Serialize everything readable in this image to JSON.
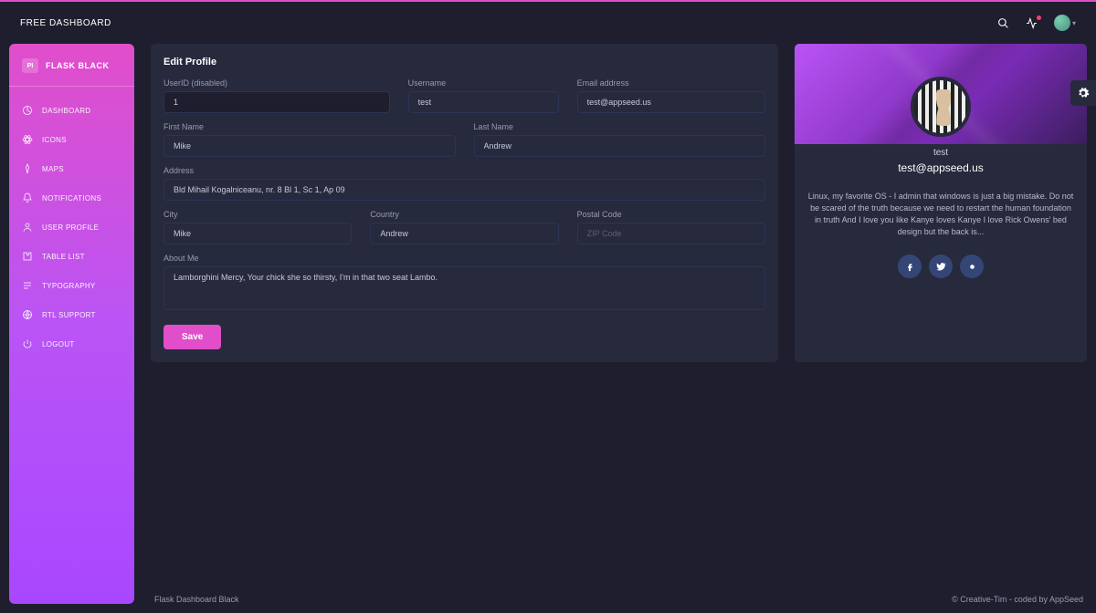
{
  "topbar": {
    "title": "FREE DASHBOARD"
  },
  "brand": {
    "logo": "PI",
    "name": "FLASK BLACK"
  },
  "sidebar": {
    "items": [
      {
        "label": "DASHBOARD",
        "icon": "chart"
      },
      {
        "label": "ICONS",
        "icon": "atom"
      },
      {
        "label": "MAPS",
        "icon": "pin"
      },
      {
        "label": "NOTIFICATIONS",
        "icon": "bell"
      },
      {
        "label": "USER PROFILE",
        "icon": "user",
        "active": true
      },
      {
        "label": "TABLE LIST",
        "icon": "puzzle"
      },
      {
        "label": "TYPOGRAPHY",
        "icon": "align"
      },
      {
        "label": "RTL SUPPORT",
        "icon": "globe"
      },
      {
        "label": "LOGOUT",
        "icon": "power"
      }
    ]
  },
  "form": {
    "title": "Edit Profile",
    "labels": {
      "userid": "UserID (disabled)",
      "username": "Username",
      "email": "Email address",
      "first": "First Name",
      "last": "Last Name",
      "address": "Address",
      "city": "City",
      "country": "Country",
      "postal": "Postal Code",
      "about": "About Me"
    },
    "values": {
      "userid": "1",
      "username": "test",
      "email": "test@appseed.us",
      "first": "Mike",
      "last": "Andrew",
      "address": "Bld Mihail Kogalniceanu, nr. 8 Bl 1, Sc 1, Ap 09",
      "city": "Mike",
      "country": "Andrew",
      "postal": "",
      "about": "Lamborghini Mercy, Your chick she so thirsty, I'm in that two seat Lambo."
    },
    "placeholders": {
      "postal": "ZIP Code"
    },
    "save": "Save"
  },
  "profile": {
    "name": "test",
    "email": "test@appseed.us",
    "bio": "Linux, my favorite OS - I admin that windows is just a big mistake. Do not be scared of the truth because we need to restart the human foundation in truth And I love you like Kanye loves Kanye I love Rick Owens' bed design but the back is..."
  },
  "footer": {
    "left": "Flask Dashboard Black",
    "right": "© Creative-Tim - coded by AppSeed"
  }
}
